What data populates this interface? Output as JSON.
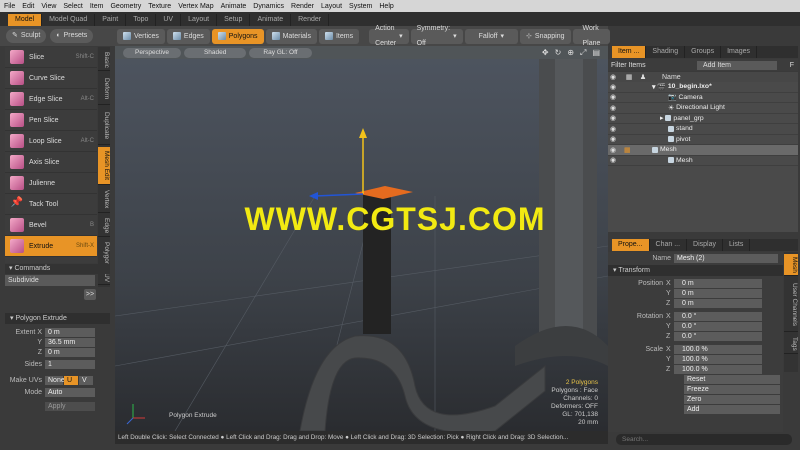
{
  "menubar": [
    "File",
    "Edit",
    "View",
    "Select",
    "Item",
    "Geometry",
    "Texture",
    "Vertex Map",
    "Animate",
    "Dynamics",
    "Render",
    "Layout",
    "System",
    "Help"
  ],
  "layout_tabs": [
    "Model",
    "Model Quad",
    "Paint",
    "Topo",
    "UV",
    "Layout",
    "Setup",
    "Animate",
    "Render"
  ],
  "tool_header": {
    "sculpt": "Sculpt",
    "presets": "Presets"
  },
  "toolbar": {
    "vertices": "Vertices",
    "edges": "Edges",
    "polygons": "Polygons",
    "materials": "Materials",
    "items": "Items",
    "action_center": "Action Center",
    "symmetry": "Symmetry: Off",
    "falloff": "Falloff",
    "snapping": "Snapping",
    "work_plane": "Work Plane"
  },
  "tools": [
    {
      "label": "Slice",
      "shortcut": "Shift-C"
    },
    {
      "label": "Curve Slice",
      "shortcut": ""
    },
    {
      "label": "Edge Slice",
      "shortcut": "Alt-C"
    },
    {
      "label": "Pen Slice",
      "shortcut": ""
    },
    {
      "label": "Loop Slice",
      "shortcut": "Alt-C"
    },
    {
      "label": "Axis Slice",
      "shortcut": ""
    },
    {
      "label": "Julienne",
      "shortcut": ""
    },
    {
      "label": "Tack Tool",
      "shortcut": ""
    },
    {
      "label": "Bevel",
      "shortcut": "B"
    },
    {
      "label": "Extrude",
      "shortcut": "Shift-X"
    }
  ],
  "side_tabs": [
    "Basic",
    "Deform",
    "Duplicate",
    "Mesh Edit",
    "Vertex",
    "Edge",
    "Polygon",
    "UV"
  ],
  "commands": {
    "header": "Commands",
    "value": "Subdivide",
    "button": ">>"
  },
  "poly_extrude": {
    "header": "Polygon Extrude",
    "extent_label": "Extent",
    "extent_x": "0 m",
    "extent_y": "36.5 mm",
    "extent_z": "0 m",
    "sides_label": "Sides",
    "sides": "1",
    "make_uvs_label": "Make UVs",
    "make_uvs_options": [
      "None",
      "U",
      "V"
    ],
    "mode_label": "Mode",
    "mode": "Auto",
    "apply": "Apply"
  },
  "viewport": {
    "perspective": "Perspective",
    "shaded": "Shaded",
    "ray_gl": "Ray GL: Off",
    "watermark": "WWW.CGTSJ.COM",
    "tool_label": "Polygon Extrude",
    "info": [
      "2 Polygons",
      "Polygons : Face",
      "Channels: 0",
      "Deformers: OFF",
      "GL: 701,138",
      "20 mm"
    ]
  },
  "statusbar": "Left Double Click: Select Connected ● Left Click and Drag: Drag and Drop: Move ● Left Click and Drag: 3D Selection: Pick ● Right Click and Drag: 3D Selection...",
  "item_tabs": [
    "Item ...",
    "Shading",
    "Groups",
    "Images"
  ],
  "item_filter": {
    "filter": "Filter Items",
    "add": "Add Item"
  },
  "item_header": {
    "name": "Name"
  },
  "items": [
    {
      "name": "10_begin.lxo*",
      "indent": 0
    },
    {
      "name": "Camera",
      "indent": 1
    },
    {
      "name": "Directional Light",
      "indent": 1
    },
    {
      "name": "panel_grp",
      "indent": 1
    },
    {
      "name": "stand",
      "indent": 1
    },
    {
      "name": "pivot",
      "indent": 1
    },
    {
      "name": "Mesh",
      "indent": 1
    },
    {
      "name": "Mesh",
      "indent": 1
    }
  ],
  "prop_tabs": [
    "Prope...",
    "Chan ...",
    "Display",
    "Lists"
  ],
  "properties": {
    "name_label": "Name",
    "name": "Mesh (2)",
    "transform": "Transform",
    "position_label": "Position",
    "pos_x": "0 m",
    "pos_y": "0 m",
    "pos_z": "0 m",
    "rotation_label": "Rotation",
    "rot_x": "0.0 °",
    "rot_y": "0.0 °",
    "rot_z": "0.0 °",
    "scale_label": "Scale",
    "scale_x": "100.0 %",
    "scale_y": "100.0 %",
    "scale_z": "100.0 %",
    "reset": "Reset",
    "freeze": "Freeze",
    "zero": "Zero",
    "add": "Add"
  },
  "right_vtabs": [
    "Mesh",
    "User Channels",
    "Tags"
  ],
  "search_placeholder": "Search..."
}
